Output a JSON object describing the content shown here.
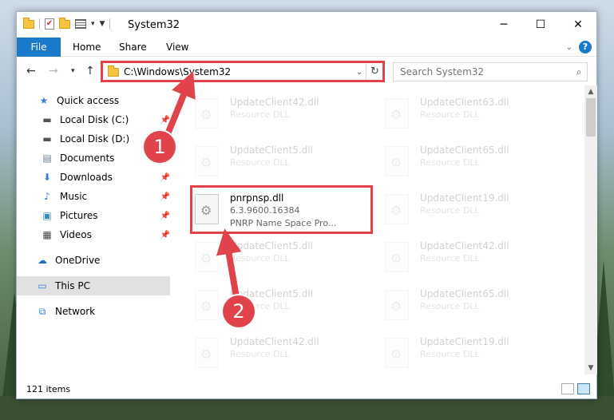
{
  "window": {
    "title": "System32",
    "controls": {
      "minimize": "─",
      "maximize": "☐",
      "close": "✕"
    }
  },
  "ribbon": {
    "tabs": [
      "File",
      "Home",
      "Share",
      "View"
    ]
  },
  "address": {
    "path": "C:\\Windows\\System32",
    "search_placeholder": "Search System32"
  },
  "sidebar": {
    "items": [
      {
        "label": "Quick access",
        "icon": "star-icon",
        "pinned": false
      },
      {
        "label": "Local Disk (C:)",
        "icon": "drive-icon",
        "pinned": true
      },
      {
        "label": "Local Disk (D:)",
        "icon": "drive-icon",
        "pinned": false
      },
      {
        "label": "Documents",
        "icon": "documents-icon",
        "pinned": true
      },
      {
        "label": "Downloads",
        "icon": "download-icon",
        "pinned": true
      },
      {
        "label": "Music",
        "icon": "music-icon",
        "pinned": true
      },
      {
        "label": "Pictures",
        "icon": "pictures-icon",
        "pinned": true
      },
      {
        "label": "Videos",
        "icon": "videos-icon",
        "pinned": true
      },
      {
        "label": "OneDrive",
        "icon": "cloud-icon",
        "pinned": false
      },
      {
        "label": "This PC",
        "icon": "computer-icon",
        "pinned": false,
        "selected": true
      },
      {
        "label": "Network",
        "icon": "network-icon",
        "pinned": false
      }
    ]
  },
  "files": {
    "left": [
      {
        "name": "UpdateClient42.dll",
        "type": "Resource DLL",
        "faded": true
      },
      {
        "name": "UpdateClient5.dll",
        "type": "Resource DLL",
        "faded": true
      },
      {
        "name": "pnrpnsp.dll",
        "version": "6.3.9600.16384",
        "type": "PNRP Name Space Pro...",
        "faded": false
      },
      {
        "name": "UpdateClient5.dll",
        "type": "Resource DLL",
        "faded": true
      },
      {
        "name": "UpdateClient5.dll",
        "type": "Resource DLL",
        "faded": true
      },
      {
        "name": "UpdateClient42.dll",
        "type": "Resource DLL",
        "faded": true
      }
    ],
    "right": [
      {
        "name": "UpdateClient63.dll",
        "type": "Resource DLL",
        "faded": true
      },
      {
        "name": "UpdateClient65.dll",
        "type": "Resource DLL",
        "faded": true
      },
      {
        "name": "UpdateClient19.dll",
        "type": "Resource DLL",
        "faded": true
      },
      {
        "name": "UpdateClient42.dll",
        "type": "Resource DLL",
        "faded": true
      },
      {
        "name": "UpdateClient65.dll",
        "type": "Resource DLL",
        "faded": true
      },
      {
        "name": "UpdateClient19.dll",
        "type": "Resource DLL",
        "faded": true
      }
    ]
  },
  "status": {
    "item_count": "121 items"
  },
  "annotations": {
    "step1": "1",
    "step2": "2",
    "color": "#e0444a"
  },
  "colors": {
    "accent": "#1979ca",
    "highlight": "#e0444a"
  }
}
